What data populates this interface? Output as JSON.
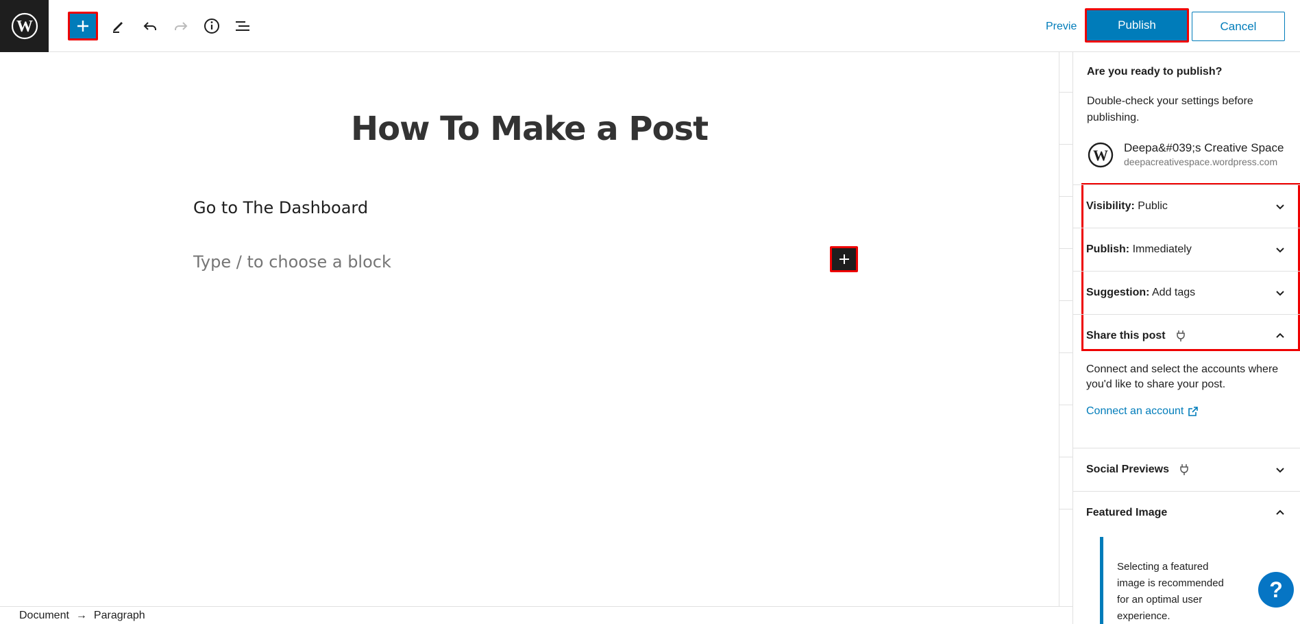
{
  "toolbar": {
    "add_block_icon": "plus-icon",
    "tools_icon": "pencil-icon",
    "undo_icon": "undo-icon",
    "redo_icon": "redo-icon",
    "details_icon": "info-icon",
    "outline_icon": "list-view-icon",
    "preview_label": "Previe",
    "publish_label": "Publish",
    "cancel_label": "Cancel"
  },
  "editor": {
    "title": "How To Make a Post",
    "paragraph": "Go to The Dashboard",
    "placeholder": "Type / to choose a block"
  },
  "footer": {
    "breadcrumb_document": "Document",
    "breadcrumb_arrow": "→",
    "breadcrumb_paragraph": "Paragraph"
  },
  "panel": {
    "ready": "Are you ready to publish?",
    "double_check": "Double-check your settings before publishing.",
    "site_name": "Deepa&#039;s Creative Space",
    "site_url": "deepacreativespace.wordpress.com",
    "visibility_label": "Visibility:",
    "visibility_value": "Public",
    "publish_label": "Publish:",
    "publish_value": "Immediately",
    "suggestion_label": "Suggestion:",
    "suggestion_value": "Add tags",
    "share_label": "Share this post",
    "share_body": "Connect and select the accounts where you'd like to share your post.",
    "connect_link": "Connect an account",
    "social_label": "Social Previews",
    "featured_label": "Featured Image",
    "featured_note": "Selecting a featured image is recommended for an optimal user experience."
  },
  "help_label": "?",
  "colors": {
    "accent": "#007cba",
    "highlight": "#ee0000",
    "dark": "#1e1e1e"
  }
}
